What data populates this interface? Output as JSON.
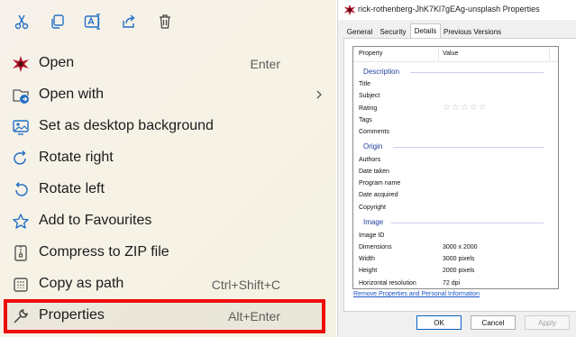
{
  "context_menu": {
    "toolbar": [
      {
        "icon": "cut-icon"
      },
      {
        "icon": "copy-icon"
      },
      {
        "icon": "rename-icon"
      },
      {
        "icon": "share-icon"
      },
      {
        "icon": "delete-icon"
      }
    ],
    "items": [
      {
        "label": "Open",
        "shortcut": "Enter",
        "icon": "image-app-icon"
      },
      {
        "label": "Open with",
        "shortcut": "",
        "icon": "open-with-icon",
        "has_submenu": true
      },
      {
        "label": "Set as desktop background",
        "shortcut": "",
        "icon": "desktop-background-icon"
      },
      {
        "label": "Rotate right",
        "shortcut": "",
        "icon": "rotate-right-icon"
      },
      {
        "label": "Rotate left",
        "shortcut": "",
        "icon": "rotate-left-icon"
      },
      {
        "label": "Add to Favourites",
        "shortcut": "",
        "icon": "star-icon"
      },
      {
        "label": "Compress to ZIP file",
        "shortcut": "",
        "icon": "zip-icon"
      },
      {
        "label": "Copy as path",
        "shortcut": "Ctrl+Shift+C",
        "icon": "copy-path-icon"
      },
      {
        "label": "Properties",
        "shortcut": "Alt+Enter",
        "icon": "wrench-icon"
      }
    ],
    "highlight_color": "#ee0d0d",
    "icon_accent": "#2470c4"
  },
  "properties_dialog": {
    "title": "rick-rothenberg-JhK7Kl7gEAg-unsplash Properties",
    "tabs": [
      "General",
      "Security",
      "Details",
      "Previous Versions"
    ],
    "active_tab": "Details",
    "columns": {
      "property": "Property",
      "value": "Value"
    },
    "groups": [
      {
        "name": "Description",
        "rows": [
          {
            "property": "Title",
            "value": ""
          },
          {
            "property": "Subject",
            "value": ""
          },
          {
            "property": "Rating",
            "value": "☆☆☆☆☆"
          },
          {
            "property": "Tags",
            "value": ""
          },
          {
            "property": "Comments",
            "value": ""
          }
        ]
      },
      {
        "name": "Origin",
        "rows": [
          {
            "property": "Authors",
            "value": ""
          },
          {
            "property": "Date taken",
            "value": ""
          },
          {
            "property": "Program name",
            "value": ""
          },
          {
            "property": "Date acquired",
            "value": ""
          },
          {
            "property": "Copyright",
            "value": ""
          }
        ]
      },
      {
        "name": "Image",
        "rows": [
          {
            "property": "Image ID",
            "value": ""
          },
          {
            "property": "Dimensions",
            "value": "3000 x 2000"
          },
          {
            "property": "Width",
            "value": "3000 pixels"
          },
          {
            "property": "Height",
            "value": "2000 pixels"
          },
          {
            "property": "Horizontal resolution",
            "value": "72 dpi"
          }
        ]
      }
    ],
    "remove_link": "Remove Properties and Personal Information",
    "buttons": {
      "ok": "OK",
      "cancel": "Cancel",
      "apply": "Apply"
    }
  }
}
